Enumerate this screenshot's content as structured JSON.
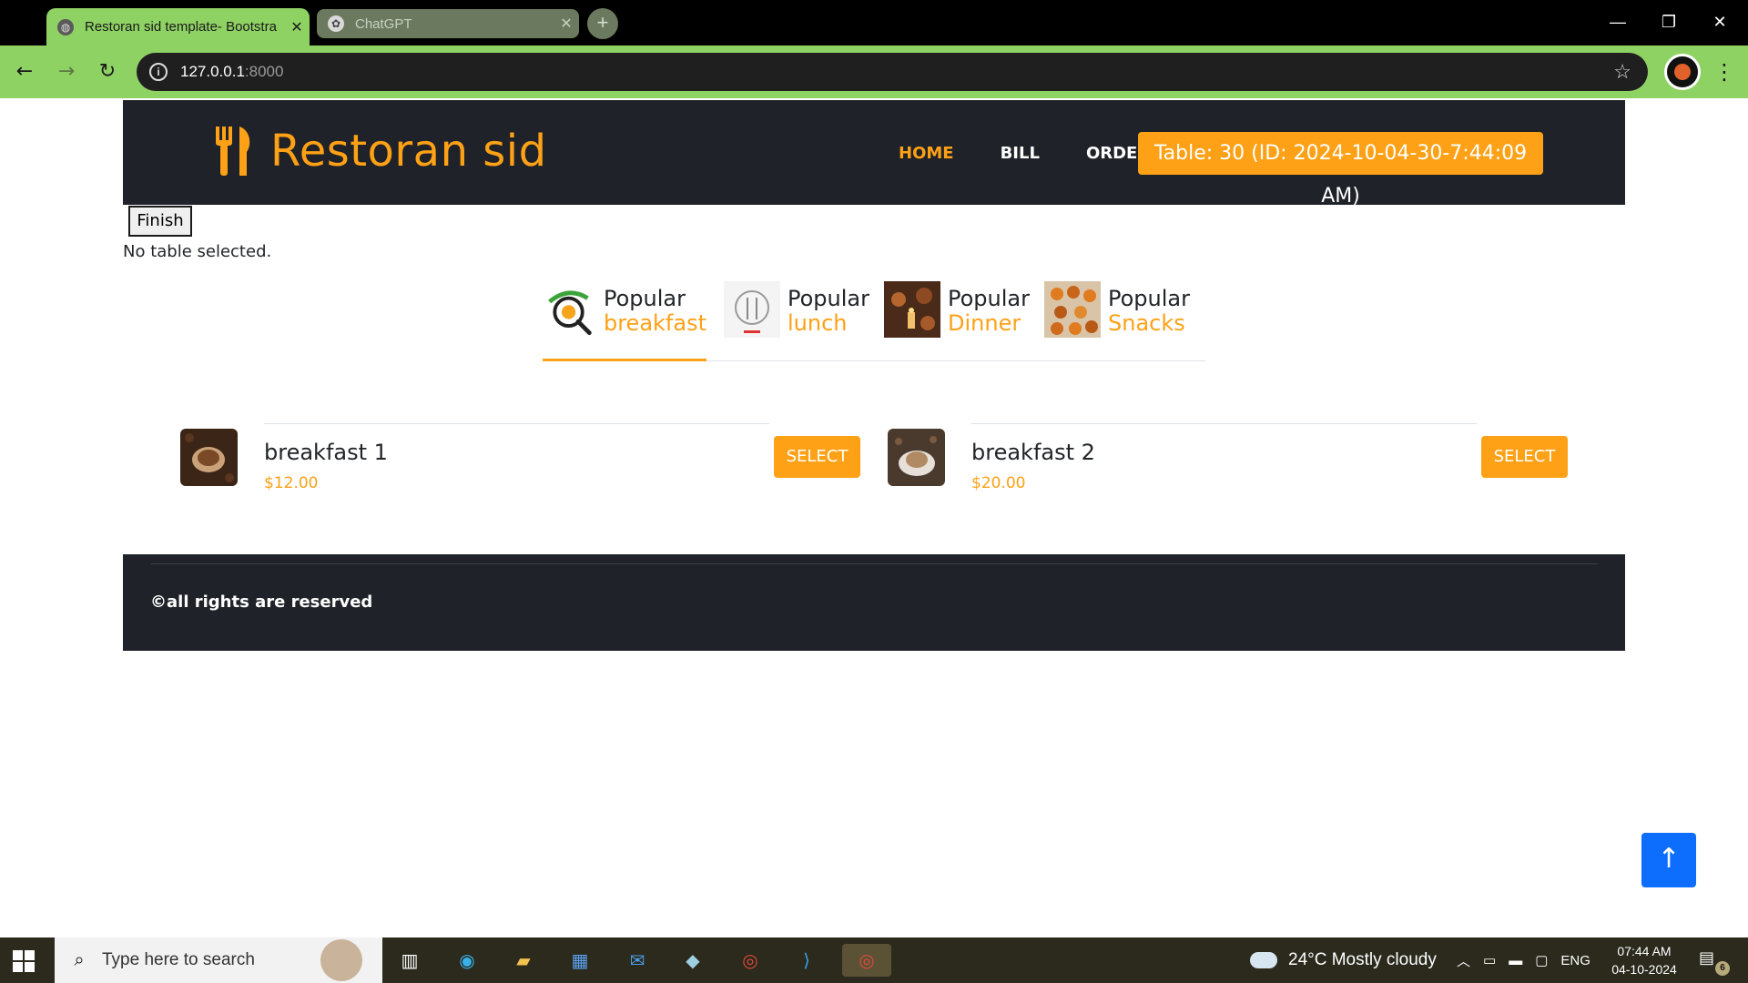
{
  "browser": {
    "tabs": [
      {
        "title": "Restoran sid template- Bootstra",
        "active": true
      },
      {
        "title": "ChatGPT",
        "active": false
      }
    ],
    "new_tab": "+",
    "address": {
      "host": "127.0.0.1",
      "port": ":8000"
    },
    "window_controls": {
      "minimize": "—",
      "restore": "❐",
      "close": "✕"
    }
  },
  "site": {
    "brand": "Restoran sid",
    "nav": [
      "HOME",
      "BILL",
      "ORDER"
    ],
    "active_nav": "HOME",
    "table_badge": "Table: 30 (ID: 2024-10-04-30-7:44:09 AM)"
  },
  "controls": {
    "finish": "Finish",
    "status": "No table selected."
  },
  "menu_tabs": [
    {
      "line1": "Popular",
      "line2": "breakfast",
      "active": true
    },
    {
      "line1": "Popular",
      "line2": "lunch",
      "active": false
    },
    {
      "line1": "Popular",
      "line2": "Dinner",
      "active": false
    },
    {
      "line1": "Popular",
      "line2": "Snacks",
      "active": false
    }
  ],
  "items": [
    {
      "name": "breakfast 1",
      "price": "$12.00",
      "button": "SELECT"
    },
    {
      "name": "breakfast 2",
      "price": "$20.00",
      "button": "SELECT"
    }
  ],
  "footer": {
    "copyright": "©all rights are reserved"
  },
  "back_to_top": "↑",
  "taskbar": {
    "search_placeholder": "Type here to search",
    "weather": "24°C  Mostly cloudy",
    "language": "ENG",
    "time": "07:44 AM",
    "date": "04-10-2024",
    "notifications": "6"
  },
  "colors": {
    "accent": "#fea116",
    "dark": "#1f2228",
    "chrome_green": "#8fd264",
    "primary_blue": "#0d6efd"
  }
}
